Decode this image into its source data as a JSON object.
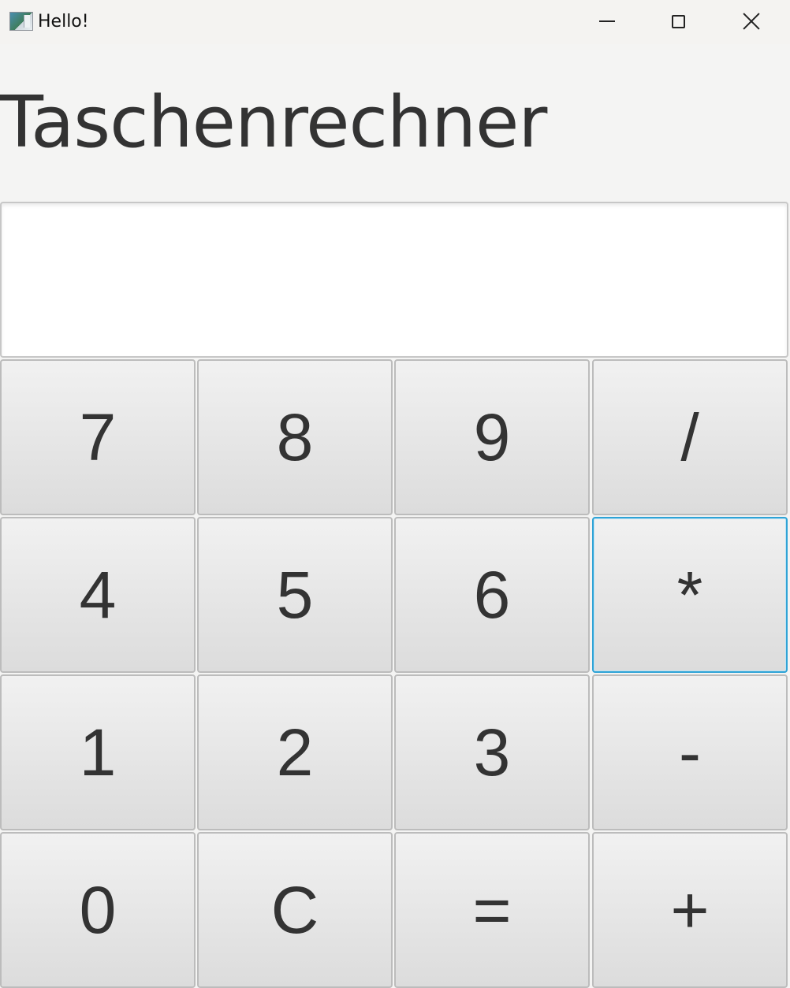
{
  "window": {
    "title": "Hello!",
    "icon": "java-app-icon"
  },
  "heading": "Taschenrechner",
  "display": {
    "value": ""
  },
  "keys": [
    [
      "7",
      "8",
      "9",
      "/"
    ],
    [
      "4",
      "5",
      "6",
      "*"
    ],
    [
      "1",
      "2",
      "3",
      "-"
    ],
    [
      "0",
      "C",
      "=",
      "+"
    ]
  ],
  "focused_key": "*",
  "colors": {
    "background": "#f4f4f3",
    "button_top": "#f1f1f1",
    "button_bottom": "#dcdcdc",
    "focus_border": "#2fa3d6",
    "text": "#333333"
  }
}
